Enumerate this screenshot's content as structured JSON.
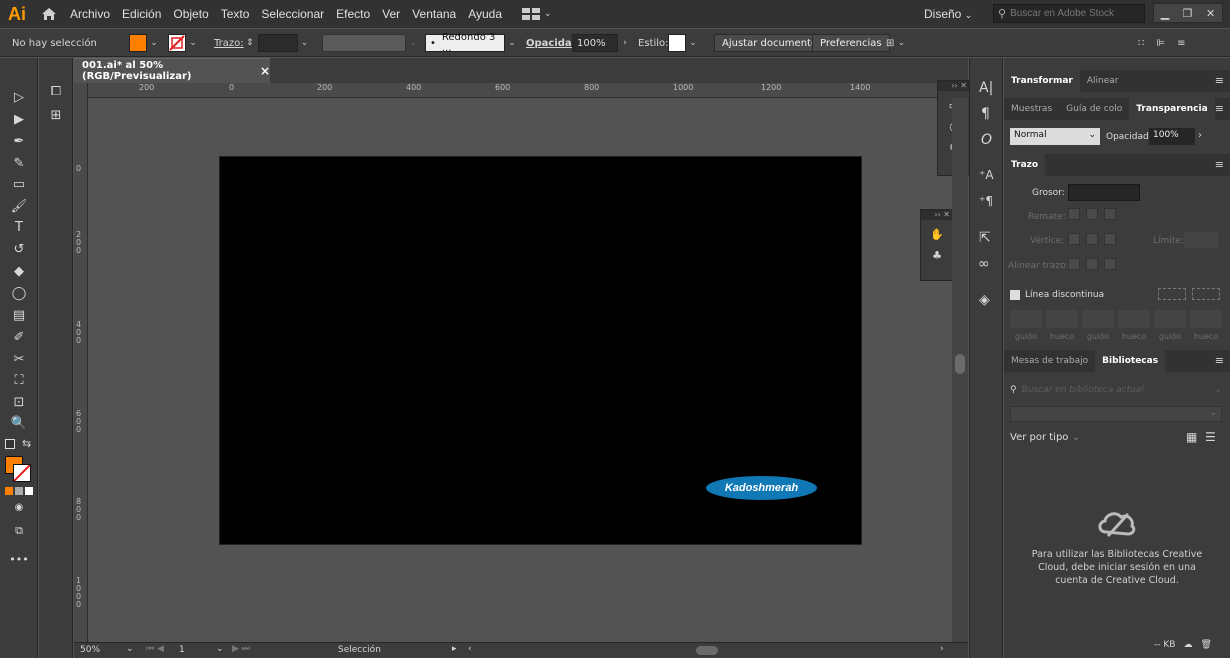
{
  "app": {
    "logo": "Ai"
  },
  "menubar": {
    "items": [
      "Archivo",
      "Edición",
      "Objeto",
      "Texto",
      "Seleccionar",
      "Efecto",
      "Ver",
      "Ventana",
      "Ayuda"
    ],
    "workspace": "Diseño",
    "search_placeholder": "Buscar en Adobe Stock"
  },
  "controlbar": {
    "selection": "No hay selección",
    "stroke_label": "Trazo:",
    "brush": "Redondo 3 ...",
    "opacity_label": "Opacidad:",
    "opacity_value": "100%",
    "style_label": "Estilo:",
    "fit_button": "Ajustar documento",
    "prefs_button": "Preferencias",
    "fill_color": "#ff7f00"
  },
  "document": {
    "tab_title": "001.ai* al 50% (RGB/Previsualizar)",
    "close": "×",
    "artboard_text": "Kadoshmerah",
    "ellipse_color": "#1178b6"
  },
  "rulers": {
    "h_ticks": [
      "200",
      "0",
      "200",
      "400",
      "600",
      "800",
      "1000",
      "1200",
      "1400"
    ],
    "v_ticks": [
      "0",
      "2\n0\n0",
      "4\n0\n0",
      "6\n0\n0",
      "8\n0\n0",
      "1\n0\n0\n0"
    ]
  },
  "statusbar": {
    "zoom": "50%",
    "artboard_num": "1",
    "tool": "Selección"
  },
  "panels": {
    "transform_tabs": [
      "Transformar",
      "Alinear"
    ],
    "transparency_tabs": [
      "Muestras",
      "Guía de colo",
      "Transparencia"
    ],
    "blend_mode": "Normal",
    "opacity_label": "Opacidad:",
    "opacity_value": "100%",
    "stroke_tab": "Trazo",
    "weight_label": "Grosor:",
    "cap_label": "Remate:",
    "corner_label": "Vértice:",
    "limit_label": "Límite:",
    "align_label": "Alinear trazo:",
    "dashed_label": "Línea discontinua",
    "dash_labels": [
      "guión",
      "hueco",
      "guión",
      "hueco",
      "guión",
      "hueco"
    ],
    "lib_tabs": [
      "Mesas de trabajo",
      "Bibliotecas"
    ],
    "lib_search_placeholder": "Buscar en biblioteca actual",
    "view_by": "Ver por tipo",
    "lib_message": "Para utilizar las Bibliotecas Creative Cloud, debe iniciar sesión en una cuenta de Creative Cloud.",
    "kb": "-- KB"
  }
}
